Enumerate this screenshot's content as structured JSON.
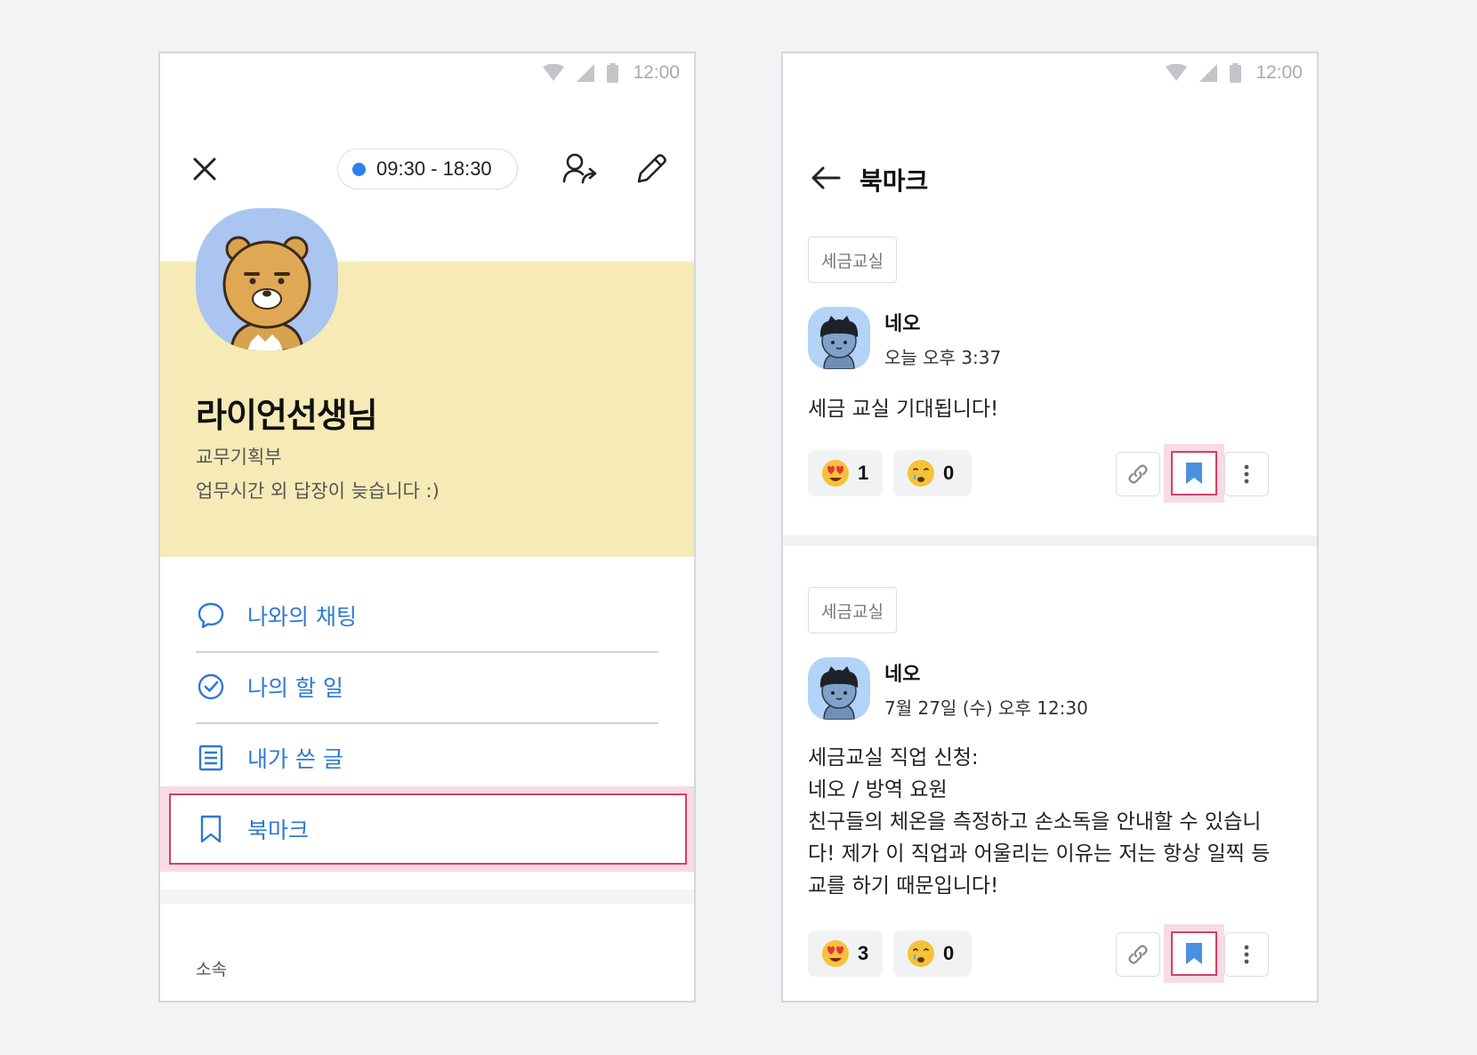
{
  "status_bar": {
    "time": "12:00"
  },
  "profile_screen": {
    "working_hours": "09:30 - 18:30",
    "name": "라이언선생님",
    "department": "교무기획부",
    "status_message": "업무시간 외 답장이 늦습니다 :)",
    "menu": [
      {
        "label": "나와의 채팅",
        "icon": "chat-bubble-icon"
      },
      {
        "label": "나의 할 일",
        "icon": "check-circle-icon"
      },
      {
        "label": "내가 쓴 글",
        "icon": "document-icon"
      },
      {
        "label": "북마크",
        "icon": "bookmark-icon",
        "highlighted": true
      }
    ],
    "section_label": "소속"
  },
  "bookmark_screen": {
    "title": "북마크",
    "posts": [
      {
        "tag": "세금교실",
        "author": "네오",
        "time": "오늘 오후 3:37",
        "body": "세금 교실 기대됩니다!",
        "reactions": [
          {
            "emoji": "heart-eyes-emoji",
            "count": "1"
          },
          {
            "emoji": "crying-emoji",
            "count": "0"
          }
        ]
      },
      {
        "tag": "세금교실",
        "author": "네오",
        "time": "7월 27일 (수) 오후 12:30",
        "body": "세금교실 직업 신청:\n네오 / 방역 요원\n친구들의 체온을 측정하고 손소독을 안내할 수 있습니\n다! 제가 이 직업과 어울리는 이유는 저는 항상 일찍 등\n교를 하기 때문입니다!",
        "reactions": [
          {
            "emoji": "heart-eyes-emoji",
            "count": "3"
          },
          {
            "emoji": "crying-emoji",
            "count": "0"
          }
        ]
      }
    ]
  },
  "colors": {
    "accent_blue": "#2f78d4",
    "profile_band": "#f6ebb6",
    "highlight_border": "#d0406c",
    "highlight_fill": "#f9dbe3"
  }
}
